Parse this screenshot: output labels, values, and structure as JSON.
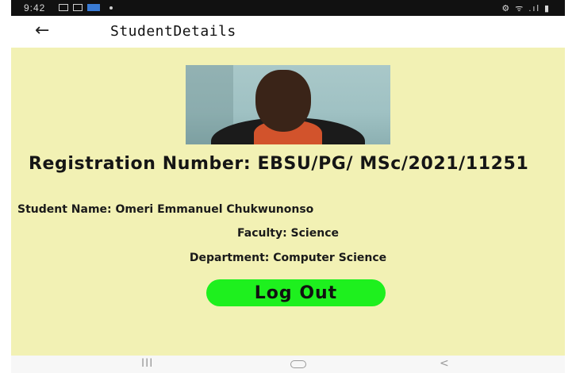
{
  "status_bar": {
    "time": "9:42",
    "right_icons": "⚙ ᯤ .ıl ▮"
  },
  "app_bar": {
    "back_icon": "←",
    "title": "StudentDetails"
  },
  "student": {
    "registration": "Registration Number: EBSU/PG/ MSc/2021/11251",
    "name": "Student Name: Omeri Emmanuel Chukwunonso",
    "faculty": "Faculty: Science",
    "department": "Department: Computer Science"
  },
  "actions": {
    "logout_label": "Log Out"
  },
  "nav_bar": {
    "recents": "III",
    "back": "<"
  },
  "colors": {
    "background": "#f2f1b4",
    "logout_button": "#1ef01e"
  }
}
